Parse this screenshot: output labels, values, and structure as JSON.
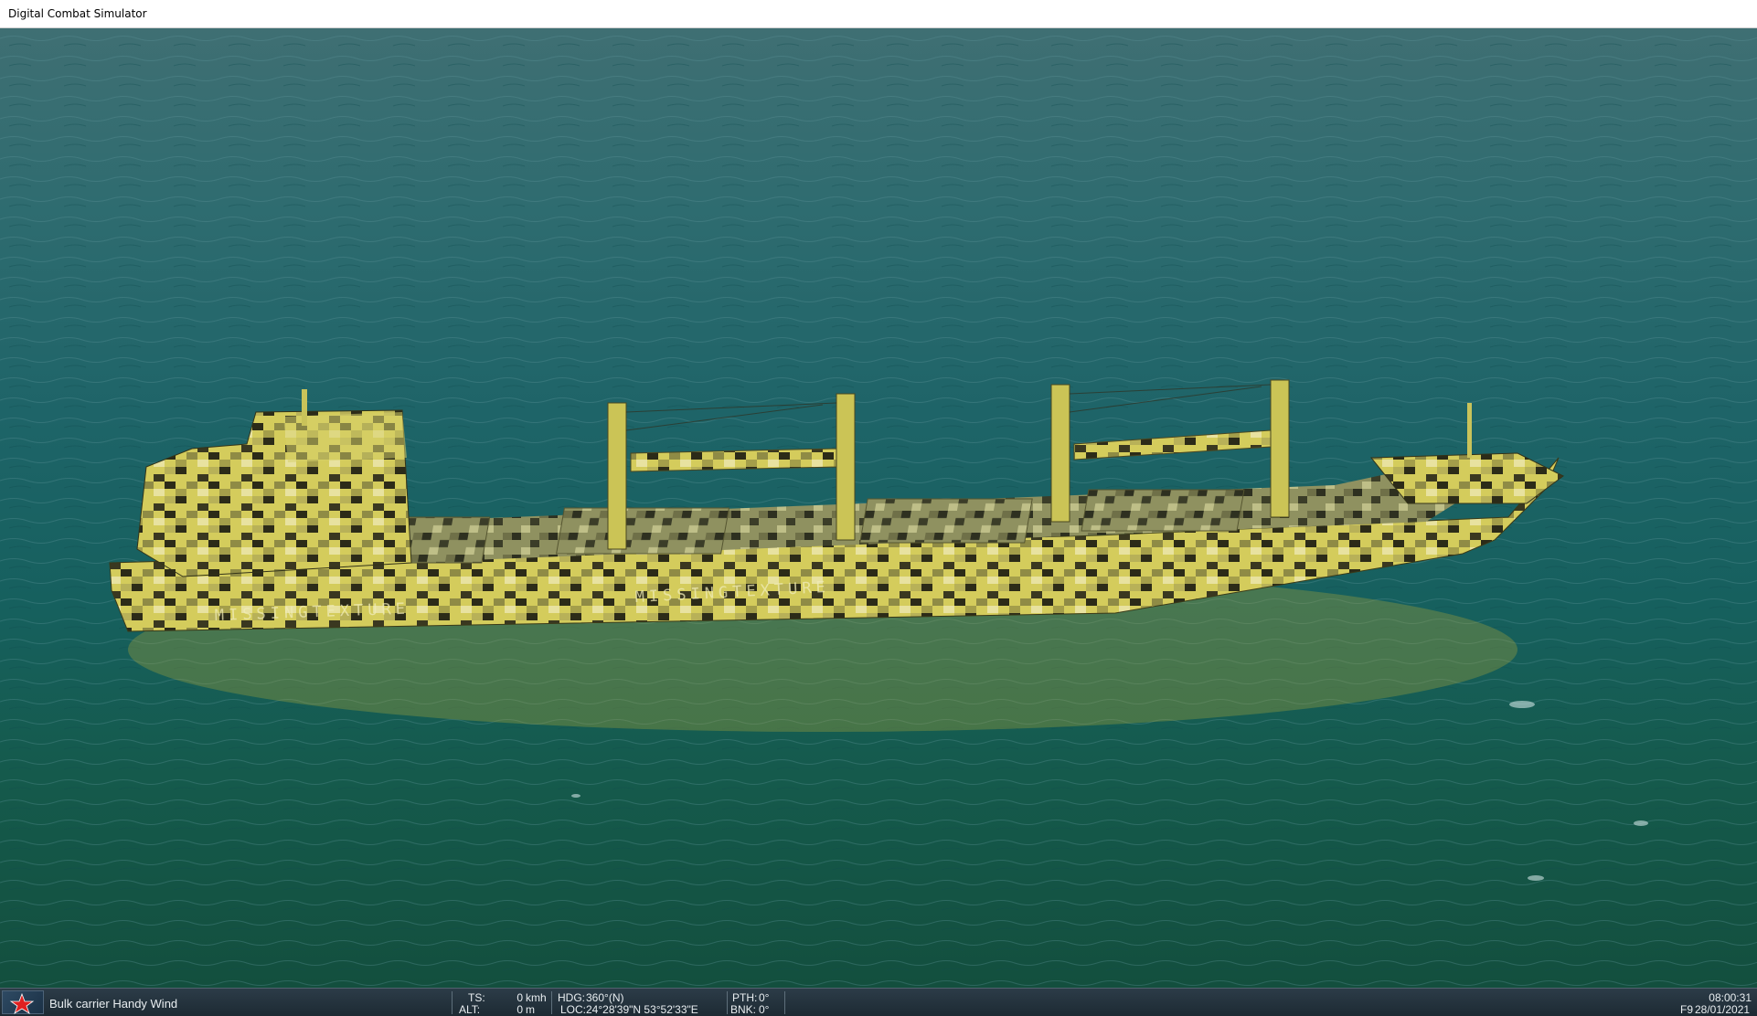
{
  "window": {
    "title": "Digital Combat Simulator"
  },
  "scene": {
    "description_icon": "ship-icon",
    "hull_text": "MISSINGTEXTURE",
    "colors": {
      "sea": "#1b6264",
      "hull_yellow": "#cfc655",
      "hull_dark": "#2b2a16"
    }
  },
  "status": {
    "unit_name": "Bulk carrier Handy Wind",
    "ts_label": "TS:",
    "ts_value": "0",
    "ts_unit": "kmh",
    "alt_label": "ALT:",
    "alt_value": "0",
    "alt_unit": "m",
    "hdg_label": "HDG:",
    "hdg_value": "360°(N)",
    "loc_label": "LOC:",
    "loc_value": "24°28'39\"N 53°52'33\"E",
    "pth_label": "PTH:",
    "pth_value": "0°",
    "bnk_label": "BNK:",
    "bnk_value": "0°",
    "time": "08:00:31",
    "view_key": "F9",
    "date": "28/01/2021"
  }
}
